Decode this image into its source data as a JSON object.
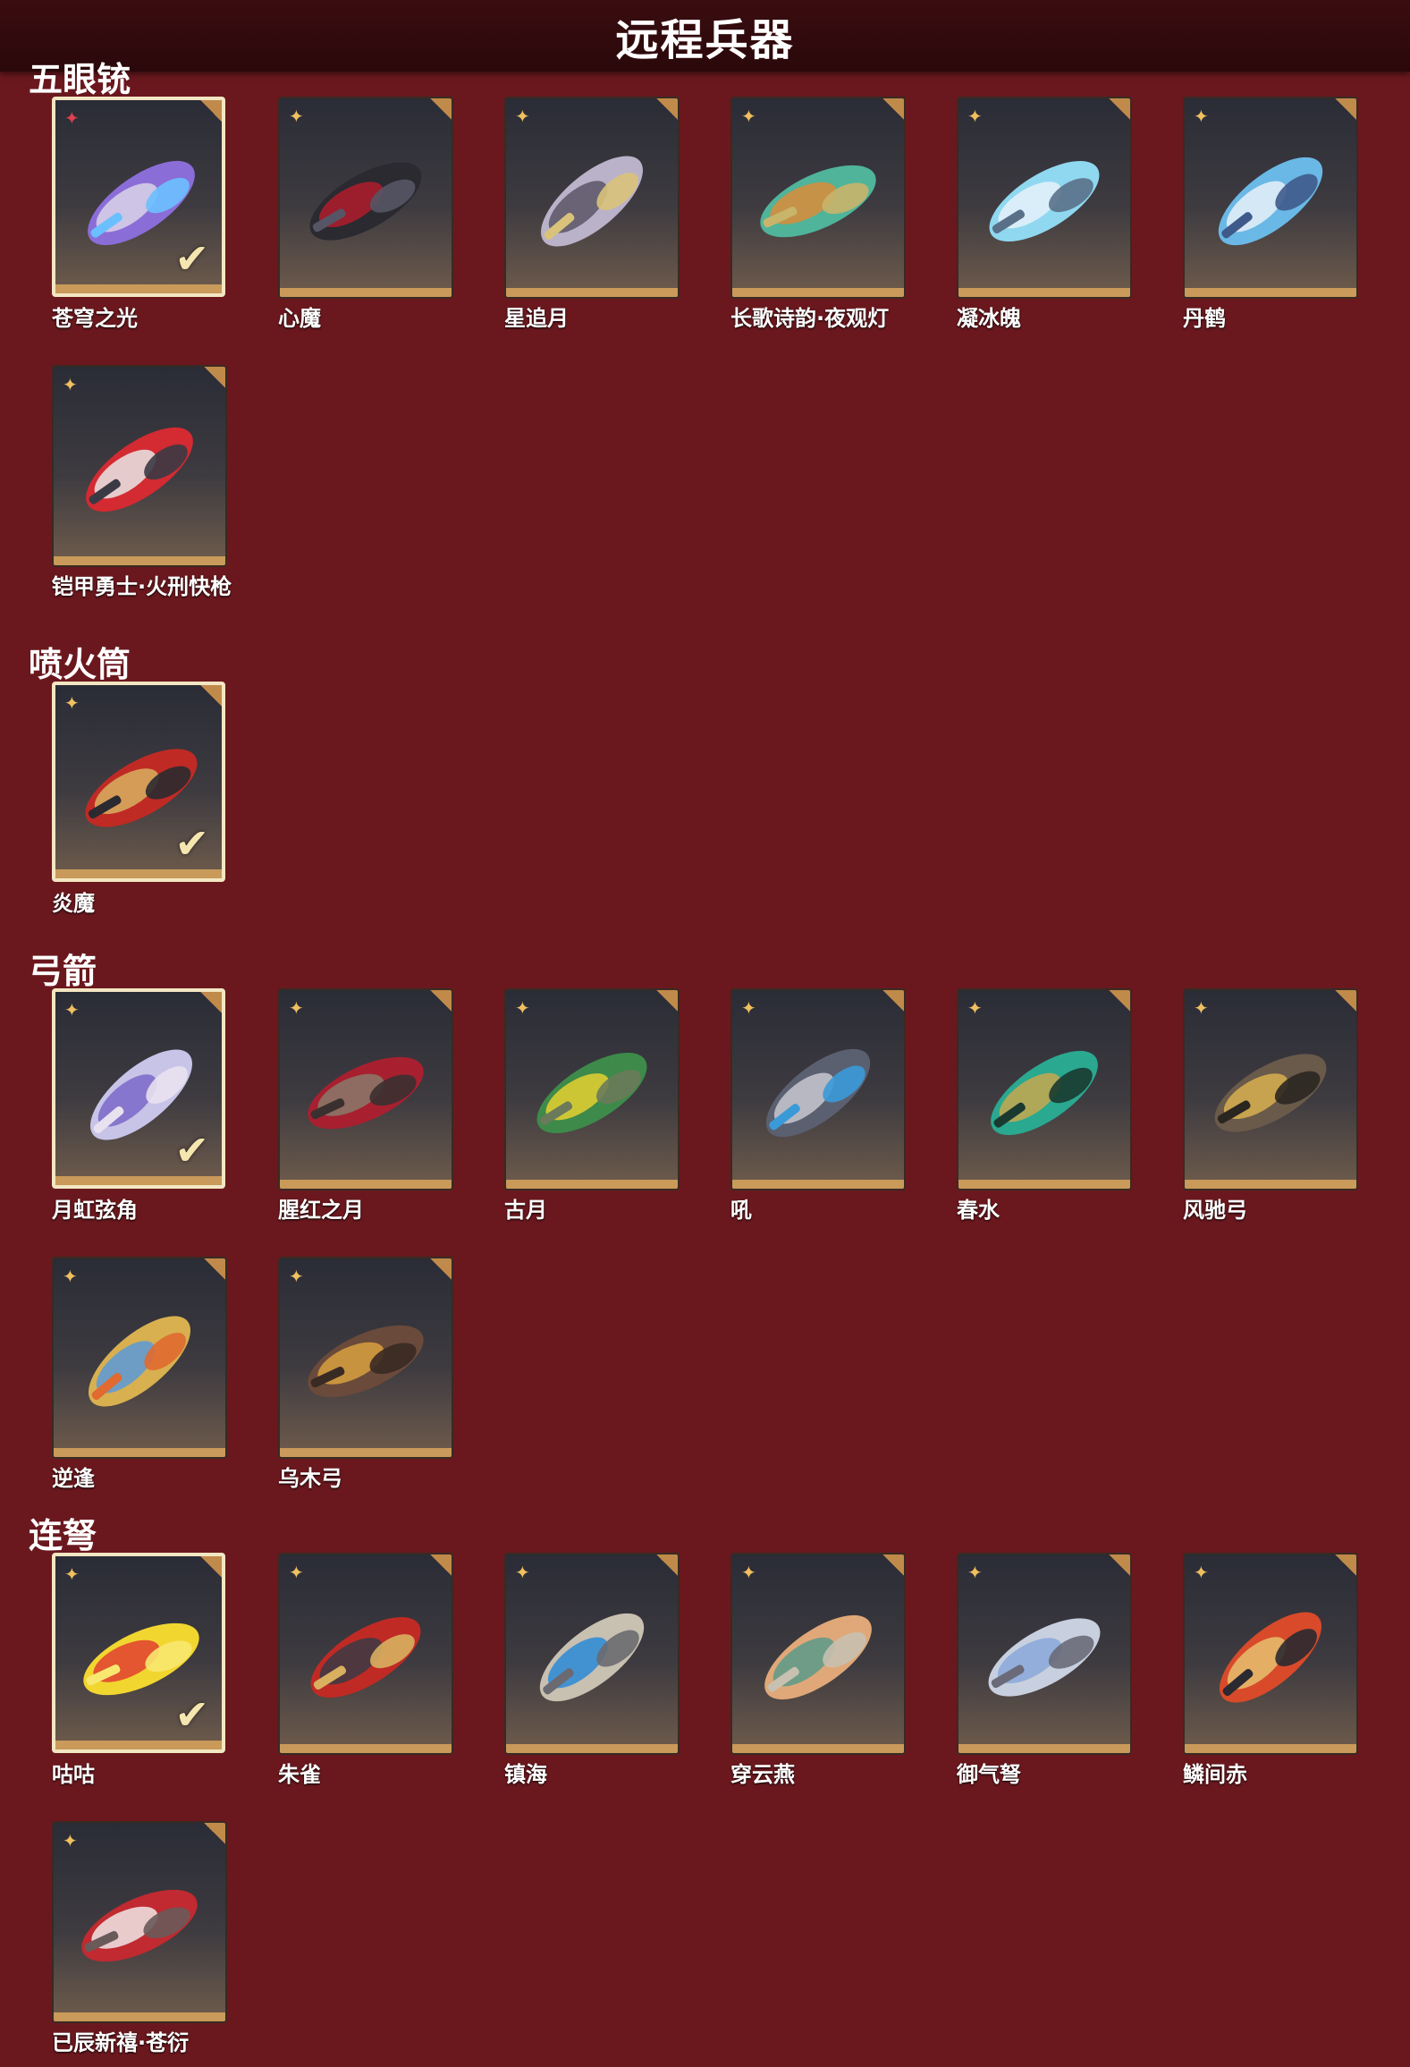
{
  "page": {
    "title": "远程兵器"
  },
  "sections": [
    {
      "title": "五眼铳",
      "items": [
        {
          "name": "苍穹之光",
          "selected": true,
          "rarity": "red",
          "colors": [
            "#8b6dd8",
            "#d9d3e8",
            "#6ac0ff"
          ]
        },
        {
          "name": "心魔",
          "selected": false,
          "rarity": "gold",
          "colors": [
            "#2a2a30",
            "#b01c2c",
            "#555566"
          ]
        },
        {
          "name": "星追月",
          "selected": false,
          "rarity": "gold",
          "colors": [
            "#b9b2c8",
            "#5a5566",
            "#d9c27a"
          ]
        },
        {
          "name": "长歌诗韵·夜观灯",
          "selected": false,
          "rarity": "gold",
          "colors": [
            "#4fb49a",
            "#d98c3a",
            "#c8b46a"
          ]
        },
        {
          "name": "凝冰魄",
          "selected": false,
          "rarity": "gold",
          "colors": [
            "#8fd8f0",
            "#e6f2fa",
            "#5a7088"
          ]
        },
        {
          "name": "丹鹤",
          "selected": false,
          "rarity": "gold",
          "colors": [
            "#6ab8e6",
            "#e8f0f8",
            "#3e5a8a"
          ]
        },
        {
          "name": "铠甲勇士·火刑快枪",
          "selected": false,
          "rarity": "gold",
          "colors": [
            "#d42a32",
            "#e8e8e8",
            "#3a3a44"
          ]
        }
      ]
    },
    {
      "title": "喷火筒",
      "items": [
        {
          "name": "炎魔",
          "selected": true,
          "rarity": "gold",
          "colors": [
            "#c02a24",
            "#d8b060",
            "#2a2a30"
          ]
        }
      ]
    },
    {
      "title": "弓箭",
      "items": [
        {
          "name": "月虹弦角",
          "selected": true,
          "rarity": "gold",
          "colors": [
            "#c8c4e8",
            "#7a68c8",
            "#e8e2f0"
          ]
        },
        {
          "name": "腥红之月",
          "selected": false,
          "rarity": "gold",
          "colors": [
            "#a82030",
            "#8a7a6a",
            "#3a3030"
          ]
        },
        {
          "name": "古月",
          "selected": false,
          "rarity": "gold",
          "colors": [
            "#3e8a4a",
            "#e6d030",
            "#6a7a5a"
          ]
        },
        {
          "name": "吼",
          "selected": false,
          "rarity": "gold",
          "colors": [
            "#5a6070",
            "#c8c8d0",
            "#3a9ad8"
          ]
        },
        {
          "name": "春水",
          "selected": false,
          "rarity": "gold",
          "colors": [
            "#2aa890",
            "#c8a850",
            "#1a3a30"
          ]
        },
        {
          "name": "风驰弓",
          "selected": false,
          "rarity": "gold",
          "colors": [
            "#6a5a4a",
            "#d8b050",
            "#2a2620"
          ]
        },
        {
          "name": "逆逢",
          "selected": false,
          "rarity": "gold",
          "colors": [
            "#d8b050",
            "#5a9ad8",
            "#e06a30"
          ]
        },
        {
          "name": "乌木弓",
          "selected": false,
          "rarity": "gold",
          "colors": [
            "#6a4a3a",
            "#d8a040",
            "#3a2a24"
          ]
        }
      ]
    },
    {
      "title": "连弩",
      "items": [
        {
          "name": "咕咕",
          "selected": true,
          "rarity": "gold",
          "colors": [
            "#f2d630",
            "#e04030",
            "#f8e870"
          ]
        },
        {
          "name": "朱雀",
          "selected": false,
          "rarity": "gold",
          "colors": [
            "#c02a24",
            "#3a3a44",
            "#d8b060"
          ]
        },
        {
          "name": "镇海",
          "selected": false,
          "rarity": "gold",
          "colors": [
            "#c8c0b0",
            "#2a8ad8",
            "#6a6a70"
          ]
        },
        {
          "name": "穿云燕",
          "selected": false,
          "rarity": "gold",
          "colors": [
            "#e0a878",
            "#5a9a8a",
            "#c8c0b0"
          ]
        },
        {
          "name": "御气弩",
          "selected": false,
          "rarity": "gold",
          "colors": [
            "#c8d0e0",
            "#8aa8d8",
            "#6a6a78"
          ]
        },
        {
          "name": "鳞间赤",
          "selected": false,
          "rarity": "gold",
          "colors": [
            "#d84a2a",
            "#e8c070",
            "#2a2a30"
          ]
        },
        {
          "name": "已辰新禧·苍衍",
          "selected": false,
          "rarity": "gold",
          "colors": [
            "#c02a30",
            "#f0e8e8",
            "#6a5a5a"
          ]
        }
      ]
    }
  ],
  "icons": {
    "rarity": "star-icon",
    "selected": "checkmark-icon"
  }
}
